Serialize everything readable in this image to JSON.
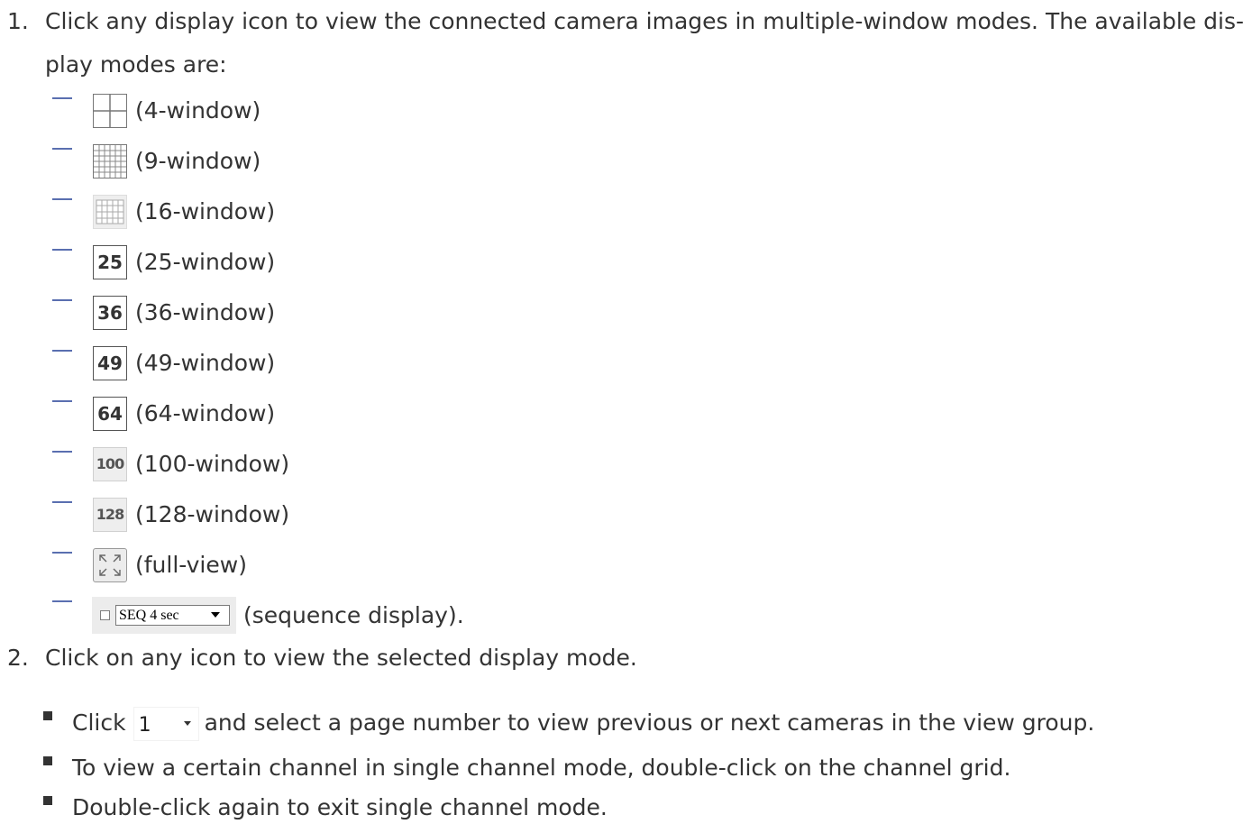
{
  "steps": [
    {
      "number": "1.",
      "line1": "Click any display icon to view the connected camera images in multiple-window modes. The available dis-",
      "line2": "play modes are:"
    },
    {
      "number": "2.",
      "line1": "Click on any icon to view the selected display mode."
    }
  ],
  "display_modes": [
    {
      "icon": "grid-2x2-icon",
      "label": "(4-window)"
    },
    {
      "icon": "grid-3x3-icon",
      "label": "(9-window)"
    },
    {
      "icon": "grid-4x4-icon",
      "label": "(16-window)"
    },
    {
      "icon_text": "25",
      "label": "(25-window)"
    },
    {
      "icon_text": "36",
      "label": "(36-window)"
    },
    {
      "icon_text": "49",
      "label": "(49-window)"
    },
    {
      "icon_text": "64",
      "label": "(64-window)"
    },
    {
      "icon_text": "100",
      "label": "(100-window)"
    },
    {
      "icon_text": "128",
      "label": "(128-window)"
    },
    {
      "icon": "full-view-icon",
      "label": "(full-view)"
    },
    {
      "icon": "sequence-control",
      "select_value": "SEQ 4 sec",
      "label": "(sequence display)."
    }
  ],
  "notes": {
    "page_note": {
      "before": "Click",
      "dropdown_value": "1",
      "after": "and select a page number to view previous or next cameras in the view group."
    },
    "single_channel": "To view a certain channel in single channel mode, double-click on the channel grid.",
    "exit_single": "Double-click again to exit single channel mode."
  },
  "colors": {
    "text": "#333333",
    "dash": "#5a6fb0",
    "bullet": "#333333"
  }
}
